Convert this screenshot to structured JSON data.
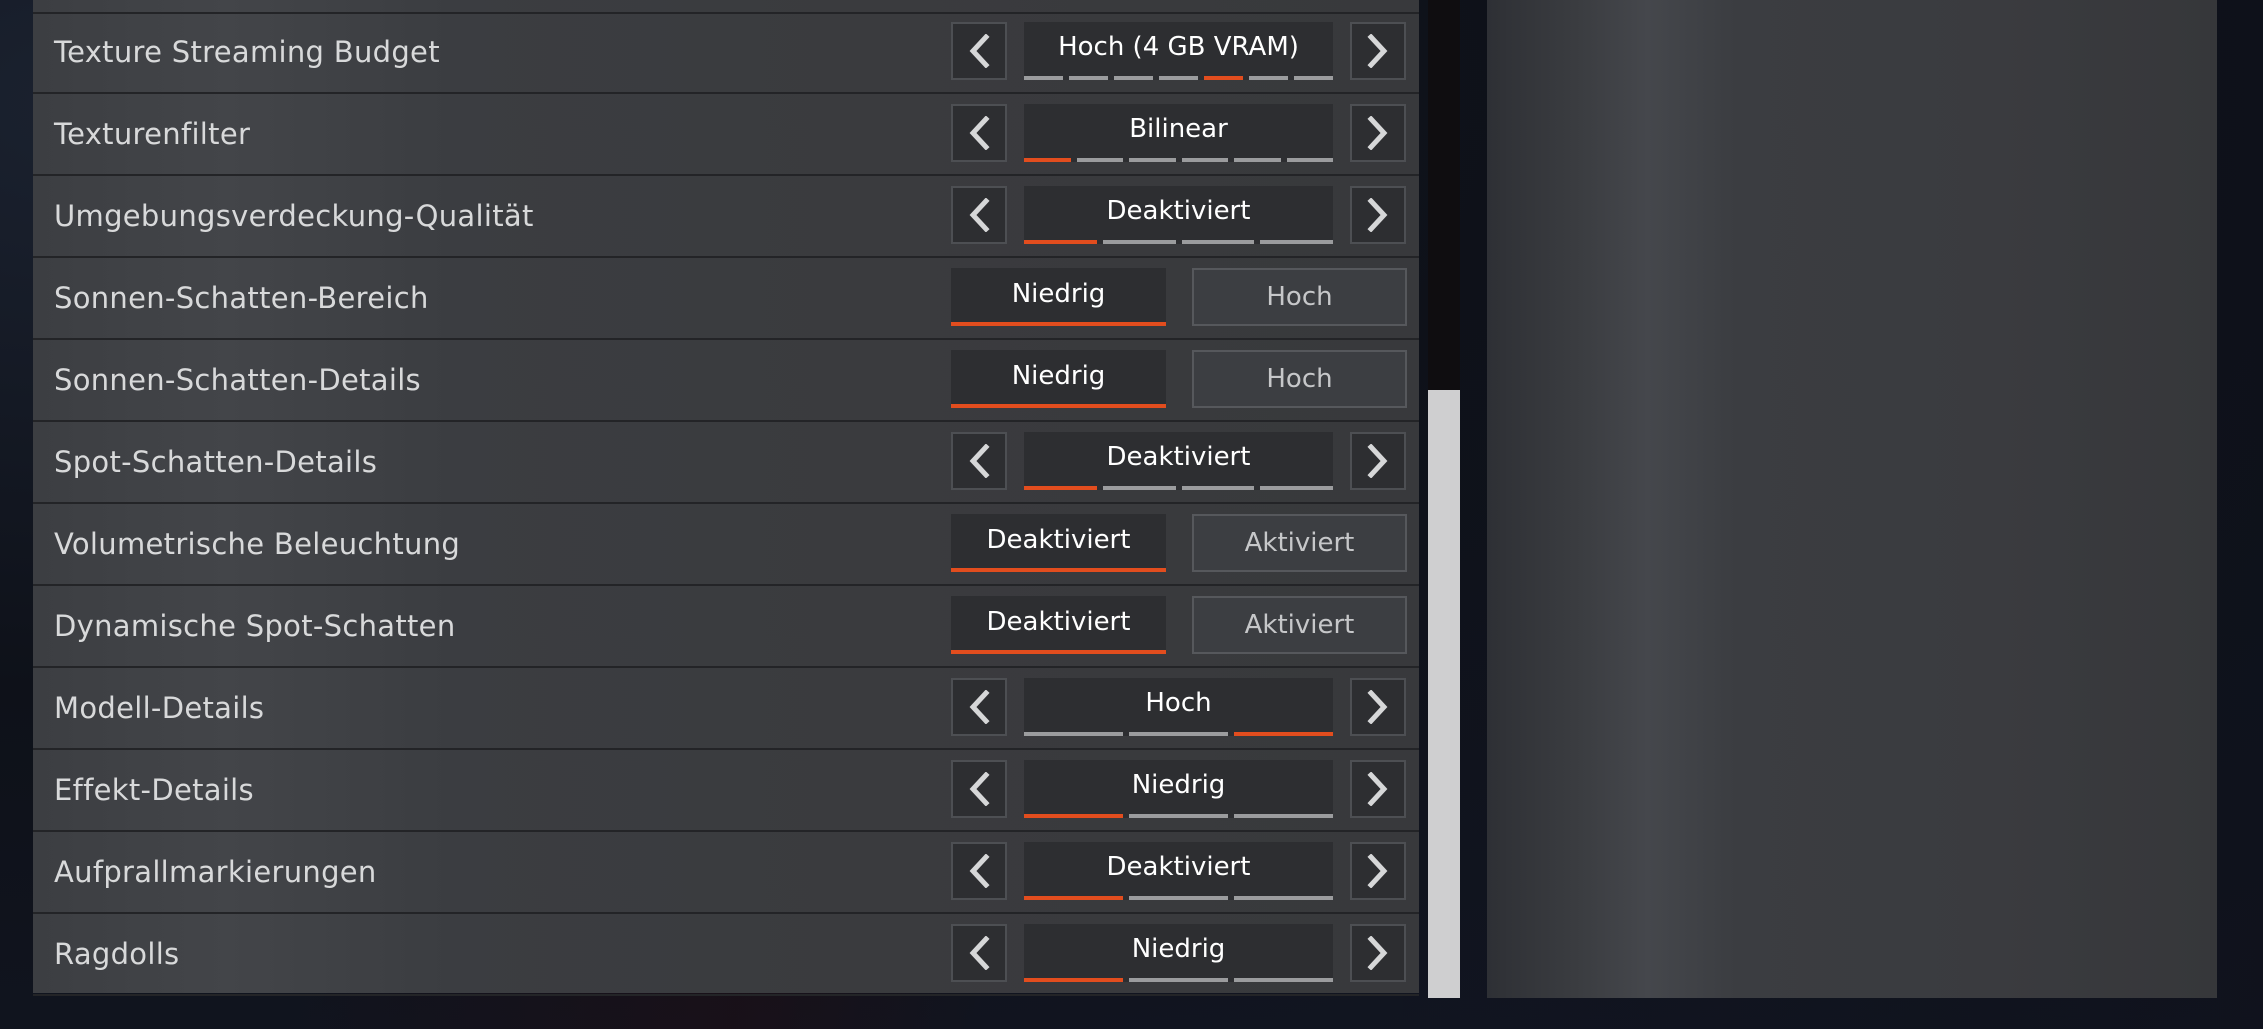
{
  "rows": [
    {
      "id": "texture-streaming-budget",
      "type": "selector",
      "label": "Texture Streaming Budget",
      "value": "Hoch (4 GB VRAM)",
      "segments": 7,
      "active": 4
    },
    {
      "id": "texturenfilter",
      "type": "selector",
      "label": "Texturenfilter",
      "value": "Bilinear",
      "segments": 6,
      "active": 0
    },
    {
      "id": "umgebungsverdeckung-qualitaet",
      "type": "selector",
      "label": "Umgebungsverdeckung-Qualität",
      "value": "Deaktiviert",
      "segments": 4,
      "active": 0
    },
    {
      "id": "sonnen-schatten-bereich",
      "type": "toggle",
      "label": "Sonnen-Schatten-Bereich",
      "on_label": "Niedrig",
      "off_label": "Hoch"
    },
    {
      "id": "sonnen-schatten-details",
      "type": "toggle",
      "label": "Sonnen-Schatten-Details",
      "on_label": "Niedrig",
      "off_label": "Hoch"
    },
    {
      "id": "spot-schatten-details",
      "type": "selector",
      "label": "Spot-Schatten-Details",
      "value": "Deaktiviert",
      "segments": 4,
      "active": 0
    },
    {
      "id": "volumetrische-beleuchtung",
      "type": "toggle",
      "label": "Volumetrische Beleuchtung",
      "on_label": "Deaktiviert",
      "off_label": "Aktiviert"
    },
    {
      "id": "dynamische-spot-schatten",
      "type": "toggle",
      "label": "Dynamische Spot-Schatten",
      "on_label": "Deaktiviert",
      "off_label": "Aktiviert"
    },
    {
      "id": "modell-details",
      "type": "selector",
      "label": "Modell-Details",
      "value": "Hoch",
      "segments": 3,
      "active": 2
    },
    {
      "id": "effekt-details",
      "type": "selector",
      "label": "Effekt-Details",
      "value": "Niedrig",
      "segments": 3,
      "active": 0
    },
    {
      "id": "aufprallmarkierungen",
      "type": "selector",
      "label": "Aufprallmarkierungen",
      "value": "Deaktiviert",
      "segments": 3,
      "active": 0
    },
    {
      "id": "ragdolls",
      "type": "selector",
      "label": "Ragdolls",
      "value": "Niedrig",
      "segments": 3,
      "active": 0
    }
  ],
  "colors": {
    "accent": "#e24d1e",
    "panel": "#3a3b3e",
    "control": "#2d2e31"
  },
  "icons": {
    "prev": "chevron-left-icon",
    "next": "chevron-right-icon"
  },
  "scroll_position": 0.61
}
